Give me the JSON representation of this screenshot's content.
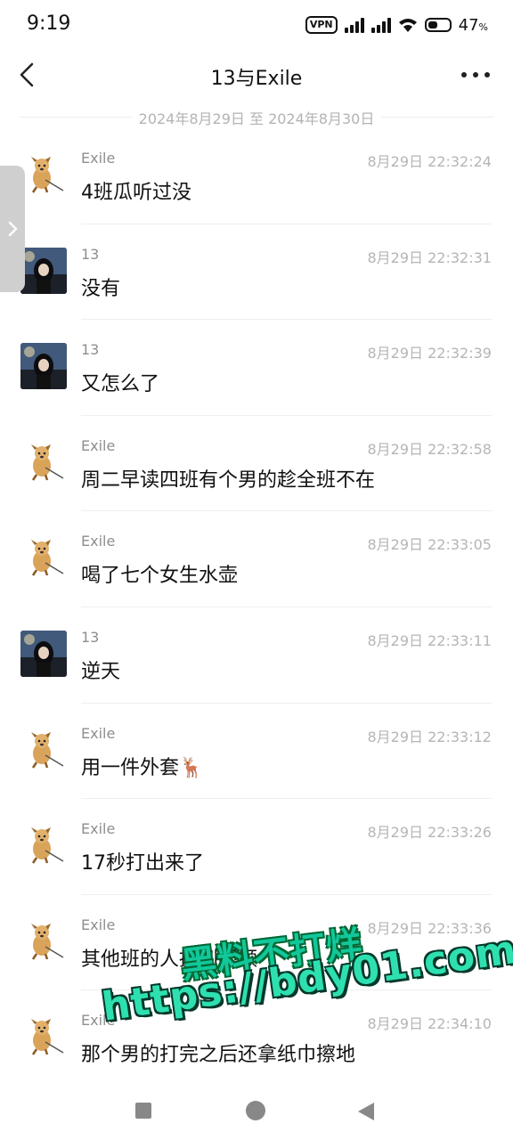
{
  "status_bar": {
    "time": "9:19",
    "vpn": "VPN",
    "battery_value": "47",
    "battery_unit": "%",
    "battery_level": 0.47
  },
  "header": {
    "title": "13与Exile"
  },
  "date_range": "2024年8月29日 至 2024年8月30日",
  "messages": [
    {
      "sender": "Exile",
      "time": "8月29日 22:32:24",
      "text": "4班瓜听过没",
      "avatar": "dog-avatar"
    },
    {
      "sender": "13",
      "time": "8月29日 22:32:31",
      "text": "没有",
      "avatar": "girl-avatar"
    },
    {
      "sender": "13",
      "time": "8月29日 22:32:39",
      "text": "又怎么了",
      "avatar": "girl-avatar"
    },
    {
      "sender": "Exile",
      "time": "8月29日 22:32:58",
      "text": "周二早读四班有个男的趁全班不在",
      "avatar": "dog-avatar"
    },
    {
      "sender": "Exile",
      "time": "8月29日 22:33:05",
      "text": "喝了七个女生水壶",
      "avatar": "dog-avatar"
    },
    {
      "sender": "13",
      "time": "8月29日 22:33:11",
      "text": "逆天",
      "avatar": "girl-avatar"
    },
    {
      "sender": "Exile",
      "time": "8月29日 22:33:12",
      "text": "用一件外套🦌",
      "avatar": "dog-avatar"
    },
    {
      "sender": "Exile",
      "time": "8月29日 22:33:26",
      "text": "17秒打出来了",
      "avatar": "dog-avatar"
    },
    {
      "sender": "Exile",
      "time": "8月29日 22:33:36",
      "text": "其他班的人搞到视频",
      "avatar": "dog-avatar"
    },
    {
      "sender": "Exile",
      "time": "8月29日 22:34:10",
      "text": "那个男的打完之后还拿纸巾擦地",
      "avatar": "dog-avatar"
    }
  ],
  "watermark": {
    "line1": "黑料不打烊",
    "line2": "https://bdy01.com"
  }
}
